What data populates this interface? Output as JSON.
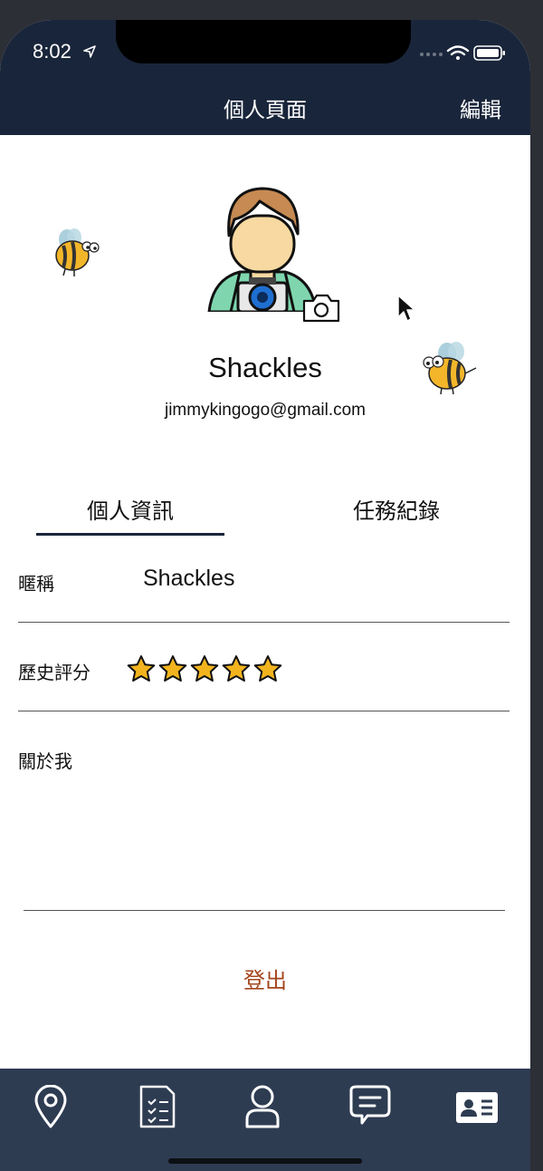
{
  "status_bar": {
    "time": "8:02"
  },
  "header": {
    "title": "個人頁面",
    "edit_label": "編輯"
  },
  "profile": {
    "name": "Shackles",
    "email": "jimmykingogo@gmail.com"
  },
  "tabs": [
    {
      "label": "個人資訊",
      "active": true
    },
    {
      "label": "任務紀錄",
      "active": false
    }
  ],
  "fields": {
    "nickname_label": "暱稱",
    "nickname_value": "Shackles",
    "rating_label": "歷史評分",
    "rating_value": 5,
    "rating_max": 5,
    "about_label": "關於我"
  },
  "logout_label": "登出",
  "tabbar": {
    "items": [
      {
        "icon": "map-pin-icon"
      },
      {
        "icon": "task-list-icon"
      },
      {
        "icon": "user-icon"
      },
      {
        "icon": "chat-icon"
      },
      {
        "icon": "id-card-icon",
        "active": true
      }
    ]
  },
  "colors": {
    "header_bg": "#19253a",
    "tabbar_bg": "#2e3c52",
    "logout": "#a3451c",
    "star": "#f2b41e"
  }
}
